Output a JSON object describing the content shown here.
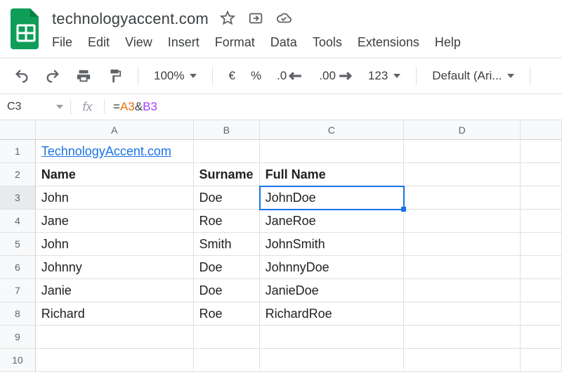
{
  "doc": {
    "title": "technologyaccent.com"
  },
  "menus": {
    "file": "File",
    "edit": "Edit",
    "view": "View",
    "insert": "Insert",
    "format": "Format",
    "data": "Data",
    "tools": "Tools",
    "extensions": "Extensions",
    "help": "Help"
  },
  "toolbar": {
    "zoom": "100%",
    "currency": "€",
    "percent": "%",
    "dec_dec": ".0",
    "inc_dec": ".00",
    "numfmt": "123",
    "font": "Default (Ari..."
  },
  "refbar": {
    "namebox": "C3",
    "fx_label": "fx",
    "formula_eq": "=",
    "formula_refA": "A3",
    "formula_amp": "&",
    "formula_refB": "B3"
  },
  "columns": [
    "A",
    "B",
    "C",
    "D",
    ""
  ],
  "row_numbers": [
    "1",
    "2",
    "3",
    "4",
    "5",
    "6",
    "7",
    "8",
    "9",
    "10"
  ],
  "selected_row": 3,
  "selected_col": "C",
  "chart_data": {
    "type": "table",
    "columns": [
      "Name",
      "Surname",
      "Full Name"
    ],
    "rows": [
      [
        "John",
        "Doe",
        "JohnDoe"
      ],
      [
        "Jane",
        "Roe",
        "JaneRoe"
      ],
      [
        "John",
        "Smith",
        "JohnSmith"
      ],
      [
        "Johnny",
        "Doe",
        "JohnnyDoe"
      ],
      [
        "Janie",
        "Doe",
        "JanieDoe"
      ],
      [
        "Richard",
        "Roe",
        "RichardRoe"
      ]
    ]
  },
  "cells": {
    "r1": {
      "A": "TechnologyAccent.com",
      "B": "",
      "C": "",
      "D": ""
    },
    "r2": {
      "A": "Name",
      "B": "Surname",
      "C": "Full Name",
      "D": ""
    },
    "r3": {
      "A": "John",
      "B": "Doe",
      "C": "JohnDoe",
      "D": ""
    },
    "r4": {
      "A": "Jane",
      "B": "Roe",
      "C": "JaneRoe",
      "D": ""
    },
    "r5": {
      "A": "John",
      "B": "Smith",
      "C": "JohnSmith",
      "D": ""
    },
    "r6": {
      "A": "Johnny",
      "B": "Doe",
      "C": "JohnnyDoe",
      "D": ""
    },
    "r7": {
      "A": "Janie",
      "B": "Doe",
      "C": "JanieDoe",
      "D": ""
    },
    "r8": {
      "A": "Richard",
      "B": "Roe",
      "C": "RichardRoe",
      "D": ""
    },
    "r9": {
      "A": "",
      "B": "",
      "C": "",
      "D": ""
    },
    "r10": {
      "A": "",
      "B": "",
      "C": "",
      "D": ""
    }
  }
}
